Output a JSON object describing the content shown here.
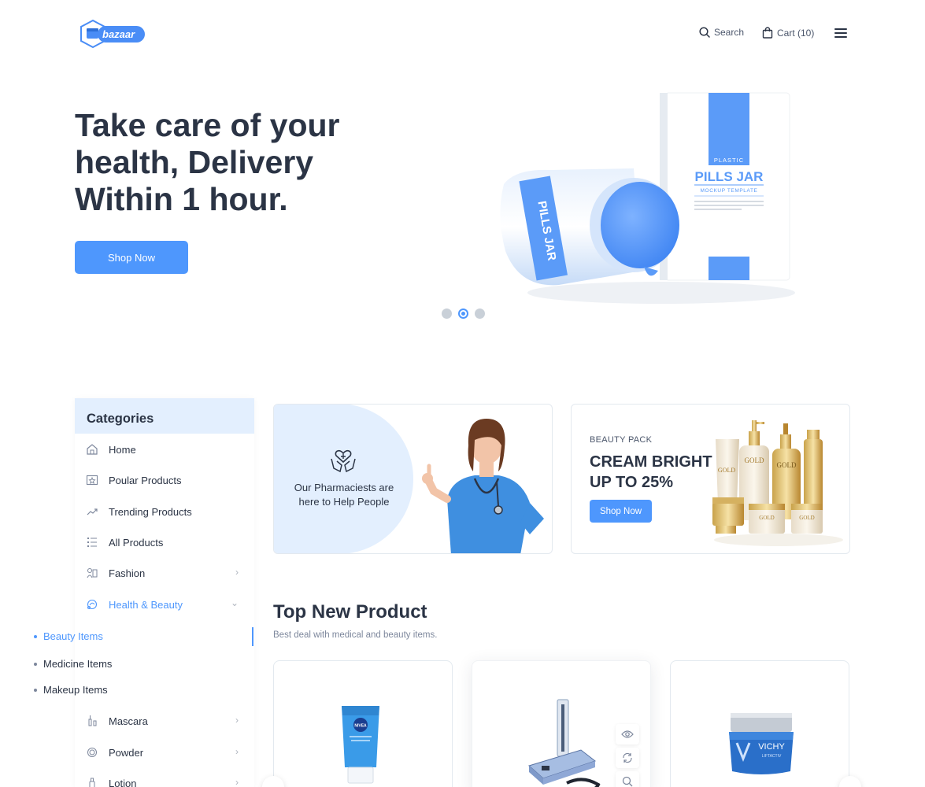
{
  "header": {
    "logo_text": "bazaar",
    "search_label": "Search",
    "cart_label": "Cart (10)"
  },
  "hero": {
    "title": "Take care of your health, Delivery Within 1 hour.",
    "button_label": "Shop Now",
    "product_labels": {
      "box_tag": "PLASTIC",
      "box_title": "PILLS JAR",
      "box_sub": "MOCKUP TEMPLATE",
      "jar_title": "PILLS JAR"
    },
    "slides": 3,
    "active_slide": 2
  },
  "sidebar": {
    "title": "Categories",
    "items": [
      {
        "label": "Home",
        "icon": "home-icon",
        "has_children": false
      },
      {
        "label": "Poular Products",
        "icon": "star-icon",
        "has_children": false
      },
      {
        "label": "Trending Products",
        "icon": "trending-icon",
        "has_children": false
      },
      {
        "label": "All Products",
        "icon": "list-icon",
        "has_children": false
      },
      {
        "label": "Fashion",
        "icon": "fashion-icon",
        "has_children": true
      },
      {
        "label": "Health & Beauty",
        "icon": "health-icon",
        "has_children": true,
        "expanded": true
      },
      {
        "label": "Mascara",
        "icon": "mascara-icon",
        "has_children": true
      },
      {
        "label": "Powder",
        "icon": "powder-icon",
        "has_children": true
      },
      {
        "label": "Lotion",
        "icon": "lotion-icon",
        "has_children": true
      }
    ],
    "subitems": [
      {
        "label": "Beauty Items",
        "active": true
      },
      {
        "label": "Medicine Items",
        "active": false
      },
      {
        "label": "Makeup Items",
        "active": false
      }
    ]
  },
  "promo1": {
    "text": "Our Pharmaciests are here to Help People"
  },
  "promo2": {
    "small": "BEAUTY PACK",
    "title": "CREAM BRIGHT UP TO 25%",
    "button_label": "Shop Now",
    "product_label": "GOLD"
  },
  "products": {
    "title": "Top New Product",
    "subtitle": "Best deal with medical and beauty items.",
    "items": [
      {
        "brand": "NIVEA"
      },
      {
        "brand": ""
      },
      {
        "brand": "VICHY",
        "sub": "LIFTACTIV"
      }
    ]
  },
  "colors": {
    "accent": "#4e97fd",
    "text": "#2b3445",
    "light_blue": "#e3effe"
  }
}
